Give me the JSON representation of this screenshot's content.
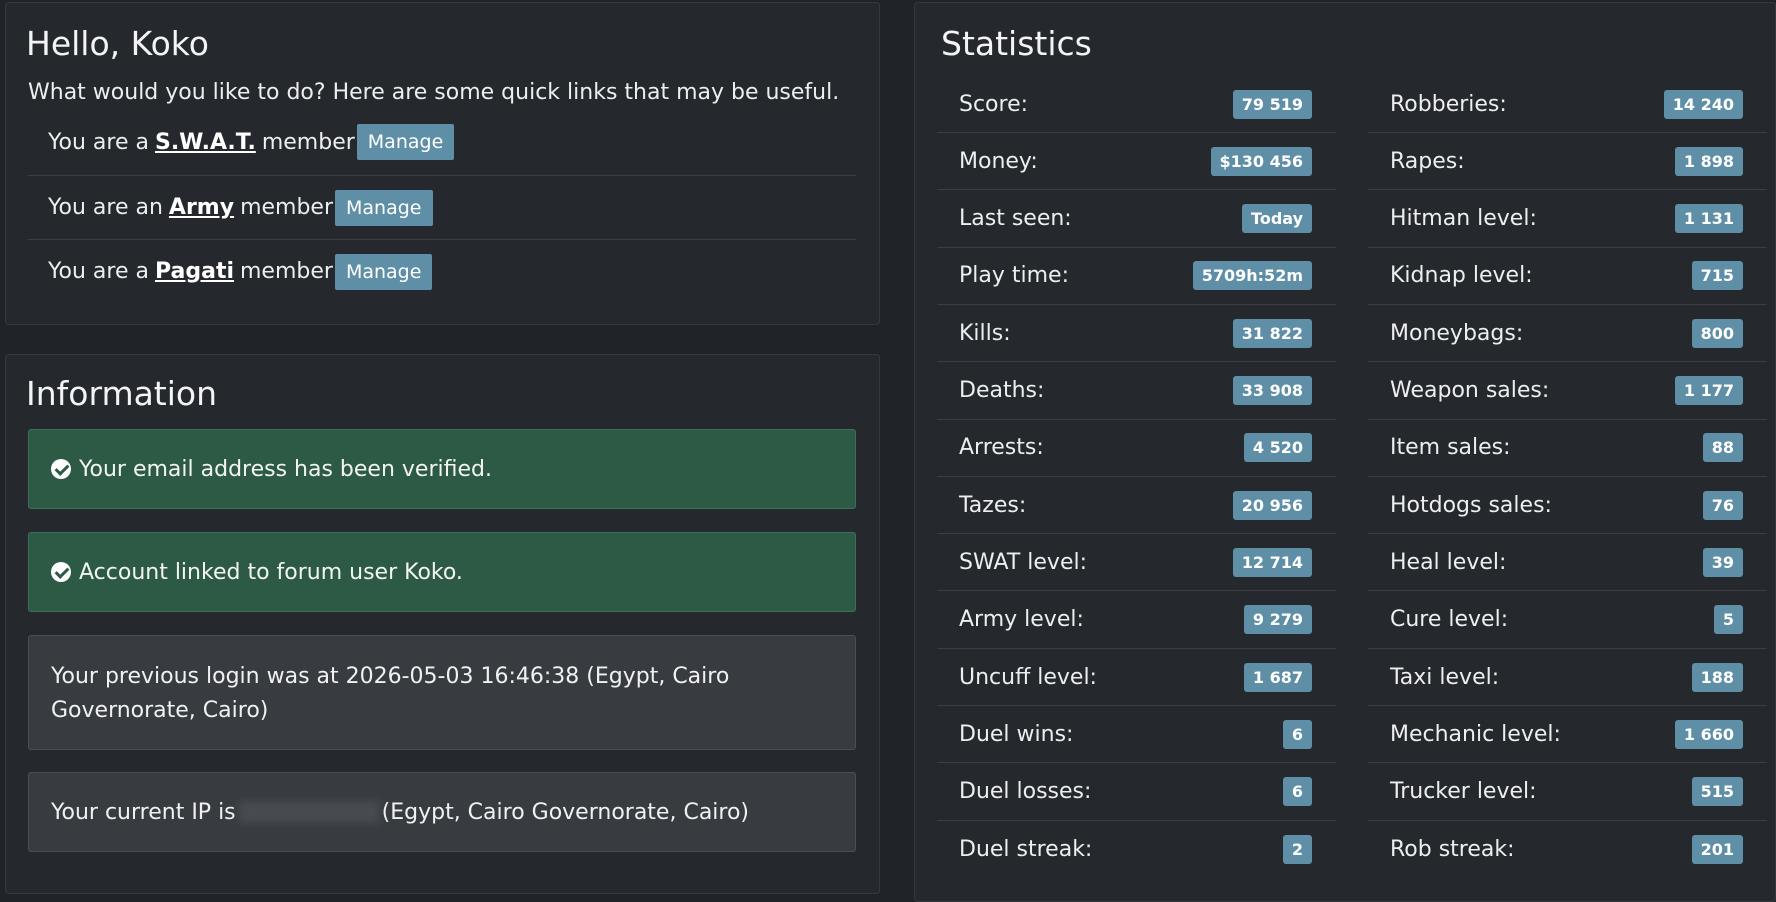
{
  "hello": {
    "title": "Hello, Koko",
    "intro": "What would you like to do? Here are some quick links that may be useful.",
    "memberships": [
      {
        "prefix": "You are a",
        "group": "S.W.A.T.",
        "suffix": "member",
        "button": "Manage"
      },
      {
        "prefix": "You are an",
        "group": "Army",
        "suffix": "member",
        "button": "Manage"
      },
      {
        "prefix": "You are a",
        "group": "Pagati",
        "suffix": "member",
        "button": "Manage"
      }
    ]
  },
  "information": {
    "title": "Information",
    "email_verified": "Your email address has been verified.",
    "forum_linked": "Account linked to forum user Koko.",
    "previous_login": "Your previous login was at 2026-05-03 16:46:38 (Egypt, Cairo Governorate, Cairo)",
    "current_ip_prefix": "Your current IP is",
    "current_ip_suffix": "(Egypt, Cairo Governorate, Cairo)"
  },
  "statistics": {
    "title": "Statistics",
    "left": [
      {
        "label": "Score:",
        "value": "79 519"
      },
      {
        "label": "Money:",
        "value": "$130 456"
      },
      {
        "label": "Last seen:",
        "value": "Today"
      },
      {
        "label": "Play time:",
        "value": "5709h:52m"
      },
      {
        "label": "Kills:",
        "value": "31 822"
      },
      {
        "label": "Deaths:",
        "value": "33 908"
      },
      {
        "label": "Arrests:",
        "value": "4 520"
      },
      {
        "label": "Tazes:",
        "value": "20 956"
      },
      {
        "label": "SWAT level:",
        "value": "12 714"
      },
      {
        "label": "Army level:",
        "value": "9 279"
      },
      {
        "label": "Uncuff level:",
        "value": "1 687"
      },
      {
        "label": "Duel wins:",
        "value": "6"
      },
      {
        "label": "Duel losses:",
        "value": "6"
      },
      {
        "label": "Duel streak:",
        "value": "2"
      }
    ],
    "right": [
      {
        "label": "Robberies:",
        "value": "14 240"
      },
      {
        "label": "Rapes:",
        "value": "1 898"
      },
      {
        "label": "Hitman level:",
        "value": "1 131"
      },
      {
        "label": "Kidnap level:",
        "value": "715"
      },
      {
        "label": "Moneybags:",
        "value": "800"
      },
      {
        "label": "Weapon sales:",
        "value": "1 177"
      },
      {
        "label": "Item sales:",
        "value": "88"
      },
      {
        "label": "Hotdogs sales:",
        "value": "76"
      },
      {
        "label": "Heal level:",
        "value": "39"
      },
      {
        "label": "Cure level:",
        "value": "5"
      },
      {
        "label": "Taxi level:",
        "value": "188"
      },
      {
        "label": "Mechanic level:",
        "value": "1 660"
      },
      {
        "label": "Trucker level:",
        "value": "515"
      },
      {
        "label": "Rob streak:",
        "value": "201"
      }
    ]
  },
  "colors": {
    "background": "#202327",
    "panel": "#25282c",
    "badge": "#5e8fa6",
    "success": "#2c5a45"
  }
}
